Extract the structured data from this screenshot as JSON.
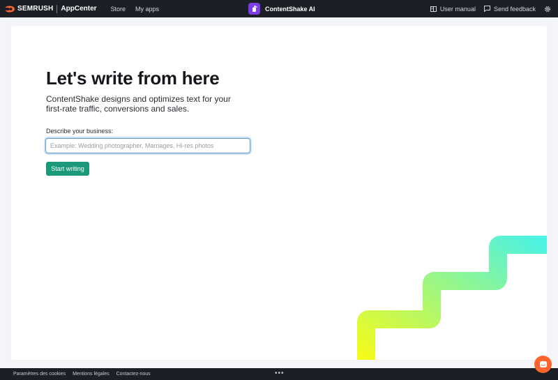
{
  "header": {
    "brand_name": "SEMRUSH",
    "brand_app": "AppCenter",
    "nav": [
      "Store",
      "My apps"
    ],
    "app_title": "ContentShake AI",
    "user_manual": "User manual",
    "send_feedback": "Send feedback"
  },
  "main": {
    "heading": "Let's write from here",
    "subtext": "ContentShake designs and optimizes text for your first-rate traffic, conversions and sales.",
    "field_label": "Describe your business:",
    "input_placeholder": "Example: Wedding photographer, Marriages, Hi-res photos",
    "input_value": "",
    "button_label": "Start writing"
  },
  "footer": {
    "links": [
      "Paramètres des cookies",
      "Mentions légales",
      "Contactez-nous"
    ],
    "more": "•••"
  },
  "colors": {
    "topbar": "#1d1f27",
    "brand_orange": "#ff642d",
    "app_purple": "#7c3de8",
    "button_green": "#1a9a7a",
    "stairs_start": "#f5fb1a",
    "stairs_end": "#4cf2e3"
  },
  "icons": {
    "brand": "semrush-flame-icon",
    "app": "contentshake-icon",
    "manual": "book-icon",
    "feedback": "message-icon",
    "settings": "gear-icon",
    "chat": "chat-icon"
  }
}
